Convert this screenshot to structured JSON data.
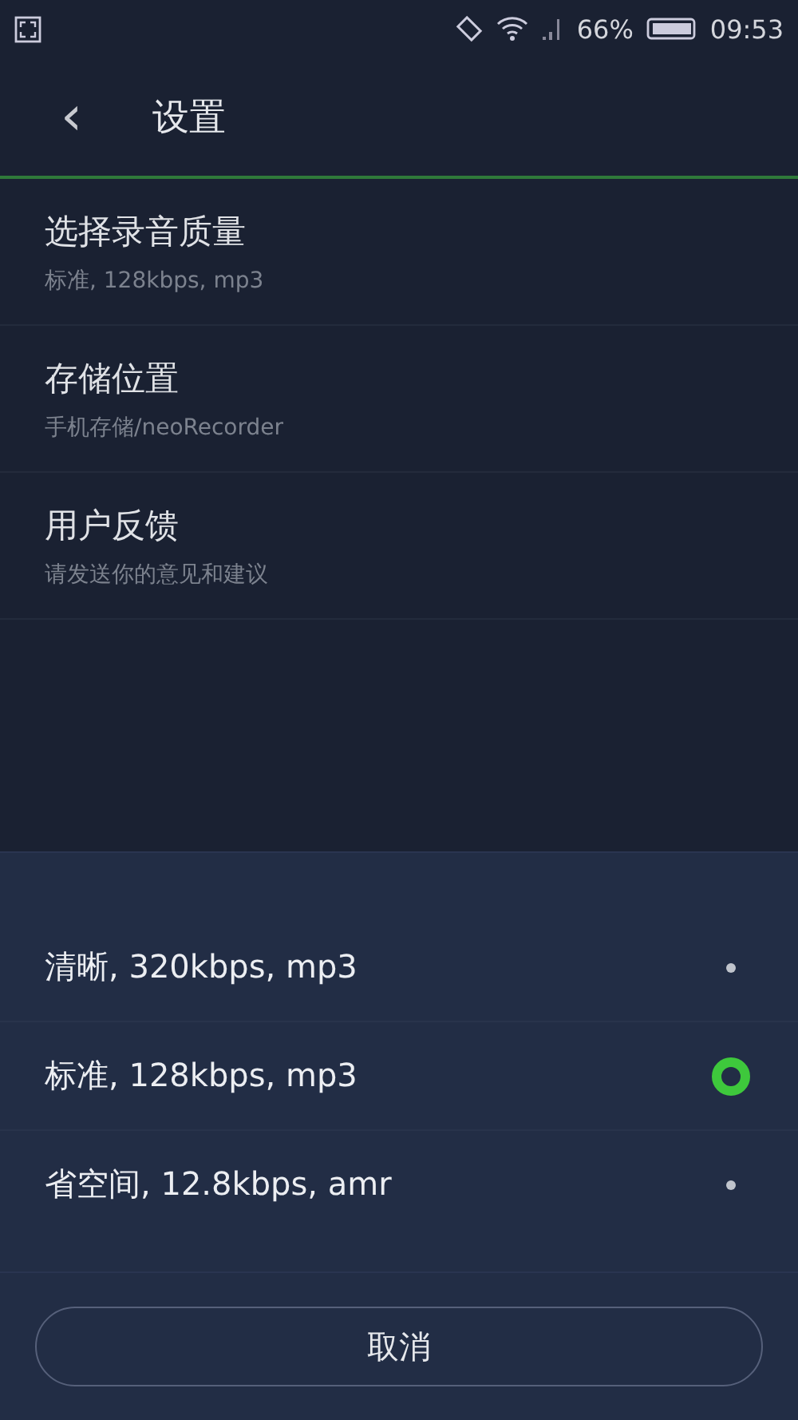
{
  "status_bar": {
    "battery_text": "66%",
    "time": "09:53"
  },
  "header": {
    "back": "‹",
    "title": "设置"
  },
  "settings": [
    {
      "title": "选择录音质量",
      "subtitle": "标准, 128kbps, mp3"
    },
    {
      "title": "存储位置",
      "subtitle": "手机存储/neoRecorder"
    },
    {
      "title": "用户反馈",
      "subtitle": "请发送你的意见和建议"
    }
  ],
  "quality_sheet": {
    "options": [
      {
        "label": "清晰, 320kbps, mp3",
        "selected": false
      },
      {
        "label": "标准, 128kbps, mp3",
        "selected": true
      },
      {
        "label": "省空间, 12.8kbps, amr",
        "selected": false
      }
    ],
    "cancel": "取消"
  }
}
